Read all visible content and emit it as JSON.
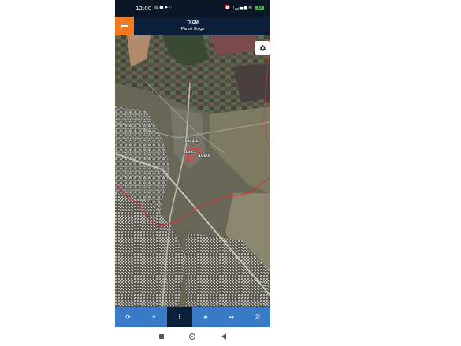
{
  "status_bar": {
    "time": "12:00",
    "left_icons": [
      "whatsapp-icon",
      "notification-icon",
      "telegram-icon",
      "more-icon"
    ],
    "right_icons": [
      "alarm-icon",
      "vibrate-icon",
      "signal-icon",
      "wifi-icon"
    ],
    "battery": "47"
  },
  "app_bar": {
    "title": "TKGM",
    "subtitle": "Parsel Sorgu",
    "menu_color": "#f47a20",
    "bar_color": "#0b1f3a"
  },
  "map": {
    "parcel_labels": [
      "1004/1",
      "106/2",
      "106/3"
    ],
    "boundary_color": "#d8343a",
    "settings_icon": "gear-icon"
  },
  "toolbar": {
    "accent": "#3a7bc8",
    "items": [
      {
        "icon": "refresh-icon",
        "glyph": "⟳"
      },
      {
        "icon": "locate-icon",
        "glyph": "⌖"
      },
      {
        "icon": "info-icon",
        "glyph": "i"
      },
      {
        "icon": "star-icon",
        "glyph": "★"
      },
      {
        "icon": "measure-icon",
        "glyph": "↔"
      },
      {
        "icon": "print-icon",
        "glyph": "⎙"
      }
    ],
    "active_index": 2
  },
  "nav_bar": {
    "items": [
      "recent-apps-button",
      "home-button",
      "back-button"
    ]
  }
}
